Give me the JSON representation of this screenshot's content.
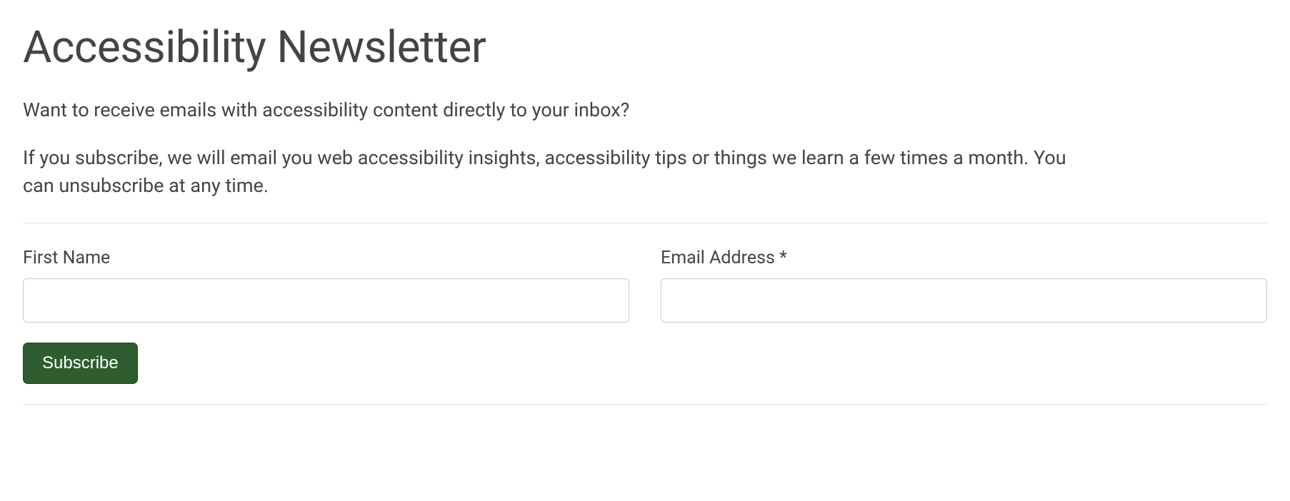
{
  "heading": "Accessibility Newsletter",
  "paragraph1": "Want to receive emails with accessibility content directly to your inbox?",
  "paragraph2": "If you subscribe, we will email you web accessibility insights, accessibility tips or things we learn a few times a month. You can unsubscribe at any time.",
  "form": {
    "first_name_label": "First Name",
    "first_name_value": "",
    "email_label": "Email Address *",
    "email_value": "",
    "subscribe_label": "Subscribe"
  }
}
